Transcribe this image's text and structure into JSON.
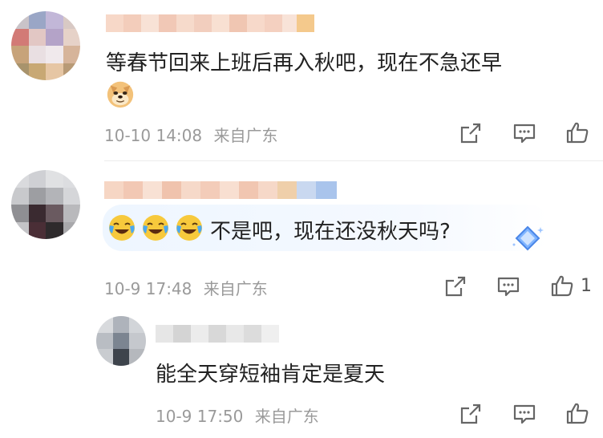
{
  "comments": [
    {
      "content": "等春节回来上班后再入秋吧，现在不急还早",
      "emoji_icon": "doge-emoji-icon",
      "time": "10-10 14:08",
      "location": "来自广东",
      "like_count": ""
    },
    {
      "content": "不是吧，现在还没秋天吗?",
      "emoji_icons": [
        "crying-laughing-icon",
        "crying-laughing-icon",
        "crying-laughing-icon"
      ],
      "time": "10-9 17:48",
      "location": "来自广东",
      "like_count": "1"
    },
    {
      "content": "能全天穿短袖肯定是夏天",
      "time": "10-9 17:50",
      "location": "来自广东",
      "like_count": ""
    }
  ],
  "colors": {
    "meta_gray": "#9a9a9a",
    "content_text": "#222222",
    "bubble_blue": "#eef6ff",
    "icon_gray": "#666666"
  }
}
